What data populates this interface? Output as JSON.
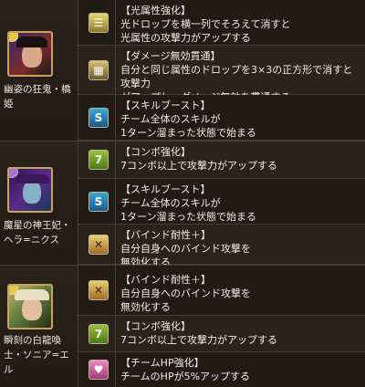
{
  "characters": [
    {
      "name_line1": "幽姿の狂鬼・橋",
      "name_line2": "姫",
      "orb_color": "#e8c84a",
      "skills": [
        {
          "icon": "row-enhance-light-icon",
          "title": "【光属性強化】",
          "lines": [
            "光ドロップを横一列でそろえて消すと",
            "光属性の攻撃力がアップする"
          ]
        },
        {
          "icon": "damage-void-pierce-icon",
          "title": "【ダメージ無効貫通】",
          "lines": [
            "自分と同じ属性のドロップを3×3の正方形で消すと攻撃力",
            "がアップし、ダメージ無効を貫通する"
          ]
        },
        {
          "icon": "skill-boost-icon",
          "title": "【スキルブースト】",
          "lines": [
            "チーム全体のスキルが",
            "1ターン溜まった状態で始まる"
          ]
        }
      ]
    },
    {
      "name_line1": "魔星の神王妃・",
      "name_line2": "ヘラ=ニクス",
      "orb_color": "#a870d8",
      "skills": [
        {
          "icon": "combo-enhance-icon",
          "title": "【コンボ強化】",
          "lines": [
            "7コンボ以上で攻撃力がアップする"
          ]
        },
        {
          "icon": "skill-boost-icon",
          "title": "【スキルブースト】",
          "lines": [
            "チーム全体のスキルが",
            "1ターン溜まった状態で始まる"
          ]
        },
        {
          "icon": "bind-resist-plus-icon",
          "title": "【バインド耐性＋】",
          "lines": [
            "自分自身へのバインド攻撃を",
            "無効化する"
          ]
        }
      ]
    },
    {
      "name_line1": "瞬刻の白龍喚",
      "name_line2": "士・ソニア=エ",
      "name_line3": "ル",
      "orb_color": "#e8c84a",
      "skills": [
        {
          "icon": "bind-resist-plus-icon",
          "title": "【バインド耐性＋】",
          "lines": [
            "自分自身へのバインド攻撃を",
            "無効化する"
          ]
        },
        {
          "icon": "combo-enhance-icon",
          "title": "【コンボ強化】",
          "lines": [
            "7コンボ以上で攻撃力がアップする"
          ]
        },
        {
          "icon": "team-hp-enhance-icon",
          "title": "【チームHP強化】",
          "lines": [
            "チームのHPが5%アップする"
          ]
        }
      ]
    }
  ],
  "icon_glyphs": {
    "row-enhance-light-icon": "☰",
    "damage-void-pierce-icon": "▦",
    "skill-boost-icon": "S",
    "combo-enhance-icon": "7",
    "bind-resist-plus-icon": "✕",
    "team-hp-enhance-icon": "♥"
  },
  "colors": {
    "border": "#4a3d30",
    "row_alt": "#2a231c",
    "text": "#f0ece4"
  }
}
